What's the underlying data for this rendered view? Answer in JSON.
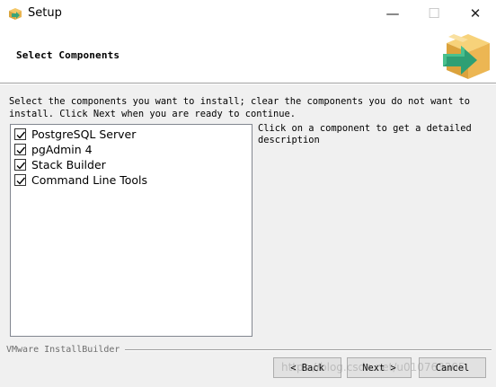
{
  "window": {
    "title": "Setup",
    "controls": {
      "minimize": "—",
      "maximize": "☐",
      "close": "✕"
    }
  },
  "header": {
    "title": "Select Components",
    "icon": "installer-box-arrow-icon"
  },
  "instructions": "Select the components you want to install; clear the components you do not want to\ninstall. Click Next when you are ready to continue.",
  "components": [
    {
      "label": "PostgreSQL Server",
      "checked": true
    },
    {
      "label": "pgAdmin 4",
      "checked": true
    },
    {
      "label": "Stack Builder",
      "checked": true
    },
    {
      "label": "Command Line Tools",
      "checked": true
    }
  ],
  "description": "Click on a component to get a detailed description",
  "branding": "VMware InstallBuilder",
  "buttons": {
    "back": "< Back",
    "next": "Next >",
    "cancel": "Cancel"
  },
  "watermark": "https://blog.csdn.net/u010763305"
}
